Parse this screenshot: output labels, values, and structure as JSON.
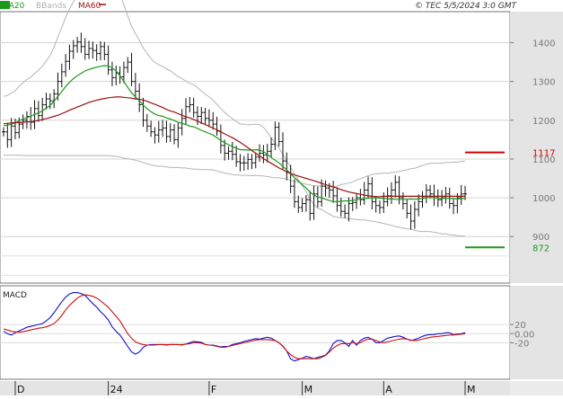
{
  "header": {
    "legend": [
      {
        "label": "MA20",
        "color": "#1a9a1a"
      },
      {
        "label": "BBands",
        "color": "#b0b0b0"
      },
      {
        "label": "MA60",
        "color": "#9a1010"
      }
    ],
    "copyright": "© TEC 5/5/2024 3:0 GMT"
  },
  "chart_data": [
    {
      "type": "ohlc",
      "title": "",
      "y_ticks": [
        900,
        1000,
        1100,
        1200,
        1300,
        1400
      ],
      "y_tick_labels": [
        "900",
        "1000",
        "1100",
        "1200",
        "1300",
        "1400"
      ],
      "ylim": [
        780,
        1480
      ],
      "x_labels": [
        "D",
        "24",
        "F",
        "M",
        "A",
        "M"
      ],
      "x_label_index": [
        3,
        27,
        53,
        77,
        98,
        119
      ],
      "n_bars": 120,
      "grid": true,
      "annotations": [
        {
          "label": "1117",
          "value": 1117,
          "color": "#cc0000"
        },
        {
          "label": "872",
          "value": 872,
          "color": "#1a9a1a"
        }
      ],
      "closes": [
        1170,
        1150,
        1185,
        1168,
        1190,
        1200,
        1210,
        1195,
        1230,
        1212,
        1240,
        1255,
        1250,
        1268,
        1300,
        1325,
        1352,
        1378,
        1392,
        1402,
        1390,
        1370,
        1385,
        1380,
        1372,
        1390,
        1370,
        1330,
        1310,
        1322,
        1312,
        1336,
        1350,
        1300,
        1275,
        1240,
        1200,
        1185,
        1170,
        1162,
        1175,
        1180,
        1158,
        1175,
        1150,
        1180,
        1205,
        1235,
        1240,
        1220,
        1210,
        1220,
        1205,
        1200,
        1190,
        1172,
        1135,
        1115,
        1120,
        1112,
        1093,
        1090,
        1090,
        1099,
        1090,
        1105,
        1115,
        1110,
        1120,
        1138,
        1182,
        1145,
        1095,
        1065,
        1030,
        990,
        975,
        985,
        995,
        960,
        1010,
        990,
        1030,
        1025,
        1020,
        1005,
        980,
        965,
        960,
        985,
        988,
        1000,
        995,
        1020,
        1036,
        990,
        980,
        975,
        990,
        1005,
        1020,
        1040,
        1000,
        985,
        960,
        940,
        970,
        990,
        1000,
        1020,
        1010,
        1000,
        995,
        1000,
        1010,
        985,
        980,
        1000,
        1010,
        1010
      ],
      "series": [
        {
          "name": "MA20",
          "color": "#1a9a1a",
          "values": [
            1186,
            1187,
            1190,
            1193,
            1199,
            1203,
            1207,
            1210,
            1215,
            1219,
            1224,
            1231,
            1238,
            1249,
            1262,
            1274,
            1287,
            1298,
            1307,
            1315,
            1321,
            1327,
            1331,
            1334,
            1337,
            1339,
            1341,
            1340,
            1335,
            1327,
            1315,
            1300,
            1285,
            1271,
            1260,
            1250,
            1239,
            1230,
            1222,
            1216,
            1212,
            1210,
            1206,
            1203,
            1199,
            1195,
            1192,
            1189,
            1185,
            1183,
            1179,
            1174,
            1170,
            1166,
            1162,
            1155,
            1148,
            1142,
            1137,
            1132,
            1128,
            1124,
            1124,
            1123,
            1123,
            1124,
            1123,
            1119,
            1112,
            1104,
            1097,
            1090,
            1081,
            1072,
            1062,
            1052,
            1043,
            1034,
            1025,
            1015,
            1007,
            1002,
            1000,
            996,
            993,
            990,
            990,
            991,
            992,
            992,
            993,
            995,
            996,
            998,
            999,
            1000,
            1000,
            999,
            999,
            997,
            997,
            996,
            996,
            996,
            996,
            997,
            996,
            997,
            998,
            1000,
            1001,
            1000,
            999,
            998,
            999,
            998,
            998,
            997,
            998,
            998
          ]
        },
        {
          "name": "MA60",
          "color": "#9a1010",
          "values": [
            1191,
            1192,
            1193,
            1194,
            1194,
            1195,
            1196,
            1196,
            1198,
            1199,
            1202,
            1204,
            1207,
            1210,
            1213,
            1217,
            1221,
            1226,
            1230,
            1234,
            1238,
            1242,
            1246,
            1249,
            1252,
            1254,
            1256,
            1258,
            1259,
            1260,
            1260,
            1259,
            1258,
            1257,
            1255,
            1254,
            1252,
            1249,
            1245,
            1241,
            1237,
            1233,
            1228,
            1224,
            1221,
            1217,
            1213,
            1209,
            1206,
            1202,
            1198,
            1193,
            1189,
            1184,
            1180,
            1175,
            1170,
            1165,
            1160,
            1155,
            1149,
            1143,
            1136,
            1129,
            1122,
            1115,
            1108,
            1101,
            1095,
            1089,
            1083,
            1077,
            1072,
            1067,
            1063,
            1059,
            1056,
            1053,
            1050,
            1047,
            1044,
            1041,
            1037,
            1034,
            1031,
            1028,
            1025,
            1021,
            1018,
            1015,
            1013,
            1011,
            1009,
            1007,
            1005,
            1004,
            1003,
            1003,
            1004,
            1004,
            1004,
            1004,
            1004,
            1004,
            1004,
            1004,
            1004,
            1004,
            1004,
            1004,
            1004,
            1004,
            1004,
            1004,
            1004,
            1004,
            1004,
            1004,
            1004,
            1004
          ]
        },
        {
          "name": "BBands",
          "color": "#b5b5b5",
          "role": "upper",
          "values": [
            1262,
            1264,
            1270,
            1276,
            1288,
            1297,
            1305,
            1311,
            1321,
            1329,
            1339,
            1353,
            1367,
            1389,
            1415,
            1439,
            1465,
            1487,
            1505,
            1521,
            1533,
            1545,
            1553,
            1559,
            1565,
            1569,
            1573,
            1571,
            1562,
            1547,
            1525,
            1498,
            1469,
            1443,
            1423,
            1406,
            1387,
            1372,
            1359,
            1349,
            1343,
            1339,
            1332,
            1328,
            1320,
            1312,
            1307,
            1301,
            1295,
            1292,
            1284,
            1275,
            1267,
            1260,
            1252,
            1241,
            1230,
            1220,
            1212,
            1204,
            1197,
            1190,
            1190,
            1188,
            1189,
            1190,
            1189,
            1182,
            1169,
            1155,
            1142,
            1128,
            1112,
            1096,
            1079,
            1062,
            1046,
            1031,
            1015,
            997,
            983,
            973,
            970,
            963,
            958,
            952,
            950,
            948,
            948,
            946,
            945,
            944,
            943,
            943,
            941,
            940,
            938,
            936,
            934,
            931,
            929,
            926,
            924,
            922,
            920,
            919,
            916,
            914,
            913,
            913,
            913,
            911,
            909,
            907,
            907,
            905,
            904,
            902,
            902,
            901
          ]
        },
        {
          "name": "BBands",
          "color": "#b5b5b5",
          "role": "lower",
          "values": [
            1110,
            1110,
            1110,
            1110,
            1110,
            1109,
            1109,
            1109,
            1109,
            1109,
            1109,
            1109,
            1109,
            1109,
            1109,
            1109,
            1109,
            1109,
            1109,
            1109,
            1109,
            1109,
            1109,
            1109,
            1109,
            1109,
            1109,
            1109,
            1108,
            1107,
            1105,
            1102,
            1101,
            1099,
            1097,
            1094,
            1091,
            1088,
            1085,
            1083,
            1081,
            1081,
            1080,
            1078,
            1078,
            1078,
            1077,
            1077,
            1075,
            1074,
            1074,
            1073,
            1073,
            1072,
            1072,
            1069,
            1066,
            1064,
            1062,
            1060,
            1059,
            1058,
            1058,
            1058,
            1057,
            1058,
            1057,
            1056,
            1055,
            1053,
            1052,
            1052,
            1050,
            1048,
            1045,
            1042,
            1040,
            1037,
            1035,
            1033,
            1031,
            1031,
            1030,
            1029,
            1028,
            1028,
            1030,
            1034,
            1036,
            1038,
            1041,
            1046,
            1049,
            1053,
            1057,
            1060,
            1062,
            1062,
            1064,
            1063,
            1065,
            1066,
            1068,
            1070,
            1072,
            1075,
            1076,
            1080,
            1083,
            1087,
            1089,
            1089,
            1089,
            1089,
            1091,
            1091,
            1092,
            1092,
            1094,
            1095
          ]
        }
      ]
    },
    {
      "type": "line",
      "title": "MACD",
      "y_ticks": [
        20,
        0,
        -20
      ],
      "y_tick_labels": [
        "20",
        "0.00",
        "-20"
      ],
      "ylim": [
        -100,
        105
      ],
      "grid": true,
      "series": [
        {
          "name": "MACD",
          "color": "#1010cc",
          "values": [
            5,
            0,
            -3,
            2,
            6,
            10,
            14,
            16,
            18,
            20,
            22,
            28,
            35,
            46,
            58,
            70,
            80,
            87,
            90,
            90,
            88,
            84,
            75,
            66,
            58,
            48,
            40,
            30,
            15,
            5,
            -3,
            -15,
            -28,
            -40,
            -45,
            -40,
            -30,
            -25,
            -24,
            -24,
            -24,
            -24,
            -25,
            -24,
            -24,
            -24,
            -25,
            -23,
            -20,
            -17,
            -18,
            -19,
            -24,
            -25,
            -25,
            -27,
            -29,
            -28,
            -28,
            -24,
            -22,
            -20,
            -17,
            -15,
            -13,
            -11,
            -12,
            -10,
            -8,
            -10,
            -15,
            -20,
            -27,
            -38,
            -55,
            -60,
            -57,
            -54,
            -50,
            -52,
            -55,
            -52,
            -50,
            -47,
            -38,
            -22,
            -15,
            -15,
            -20,
            -28,
            -15,
            -25,
            -15,
            -10,
            -8,
            -12,
            -20,
            -20,
            -15,
            -10,
            -8,
            -6,
            -5,
            -8,
            -12,
            -15,
            -13,
            -10,
            -6,
            -3,
            -2,
            -2,
            0,
            0,
            2,
            2,
            -2,
            -1,
            0,
            2
          ]
        },
        {
          "name": "Signal",
          "color": "#cc1010",
          "values": [
            10,
            8,
            5,
            4,
            3,
            4,
            6,
            8,
            10,
            12,
            13,
            15,
            18,
            22,
            30,
            40,
            52,
            62,
            70,
            78,
            83,
            85,
            84,
            82,
            78,
            72,
            65,
            58,
            48,
            38,
            28,
            14,
            0,
            -10,
            -18,
            -22,
            -24,
            -25,
            -25,
            -25,
            -24,
            -24,
            -24,
            -24,
            -24,
            -24,
            -24,
            -23,
            -22,
            -20,
            -20,
            -21,
            -24,
            -25,
            -26,
            -28,
            -30,
            -30,
            -28,
            -26,
            -24,
            -22,
            -20,
            -18,
            -16,
            -14,
            -13,
            -13,
            -13,
            -14,
            -15,
            -20,
            -28,
            -38,
            -46,
            -52,
            -55,
            -55,
            -55,
            -55,
            -55,
            -55,
            -52,
            -48,
            -40,
            -32,
            -26,
            -22,
            -22,
            -22,
            -20,
            -22,
            -20,
            -15,
            -12,
            -12,
            -15,
            -18,
            -20,
            -18,
            -16,
            -14,
            -12,
            -11,
            -12,
            -14,
            -15,
            -14,
            -12,
            -10,
            -8,
            -7,
            -6,
            -5,
            -4,
            -3,
            -3,
            -2,
            -1,
            0
          ]
        }
      ],
      "x_labels": [
        "D",
        "24",
        "F",
        "M",
        "A",
        "M"
      ]
    }
  ]
}
